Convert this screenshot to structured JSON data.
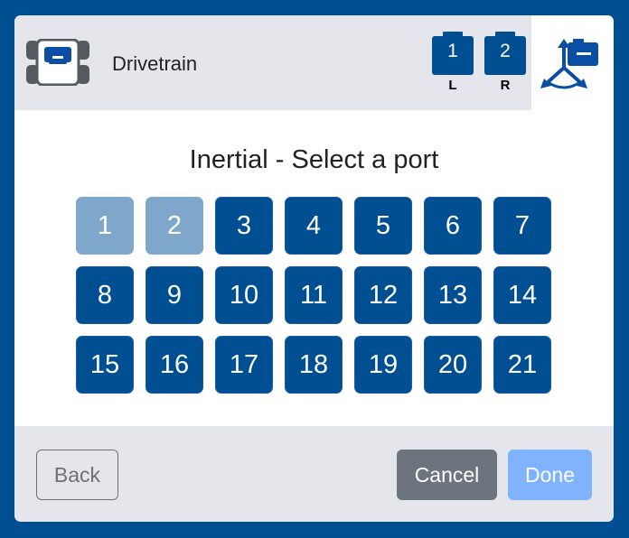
{
  "header": {
    "device_icon": "drivetrain-icon",
    "title": "Drivetrain",
    "motors": [
      {
        "number": "1",
        "side": "L"
      },
      {
        "number": "2",
        "side": "R"
      }
    ],
    "sensor_icon": "inertial-sensor-icon"
  },
  "main": {
    "prompt": "Inertial - Select a port",
    "ports": [
      {
        "label": "1",
        "state": "disabled"
      },
      {
        "label": "2",
        "state": "disabled"
      },
      {
        "label": "3",
        "state": "available"
      },
      {
        "label": "4",
        "state": "available"
      },
      {
        "label": "5",
        "state": "available"
      },
      {
        "label": "6",
        "state": "available"
      },
      {
        "label": "7",
        "state": "available"
      },
      {
        "label": "8",
        "state": "available"
      },
      {
        "label": "9",
        "state": "available"
      },
      {
        "label": "10",
        "state": "available"
      },
      {
        "label": "11",
        "state": "available"
      },
      {
        "label": "12",
        "state": "available"
      },
      {
        "label": "13",
        "state": "available"
      },
      {
        "label": "14",
        "state": "available"
      },
      {
        "label": "15",
        "state": "available"
      },
      {
        "label": "16",
        "state": "available"
      },
      {
        "label": "17",
        "state": "available"
      },
      {
        "label": "18",
        "state": "available"
      },
      {
        "label": "19",
        "state": "available"
      },
      {
        "label": "20",
        "state": "available"
      },
      {
        "label": "21",
        "state": "available"
      }
    ]
  },
  "footer": {
    "back_label": "Back",
    "cancel_label": "Cancel",
    "done_label": "Done"
  },
  "colors": {
    "frame": "#004f93",
    "port_available": "#004f93",
    "port_disabled": "#7fa6cb",
    "cancel": "#6c757d",
    "done": "#80b3ff"
  }
}
